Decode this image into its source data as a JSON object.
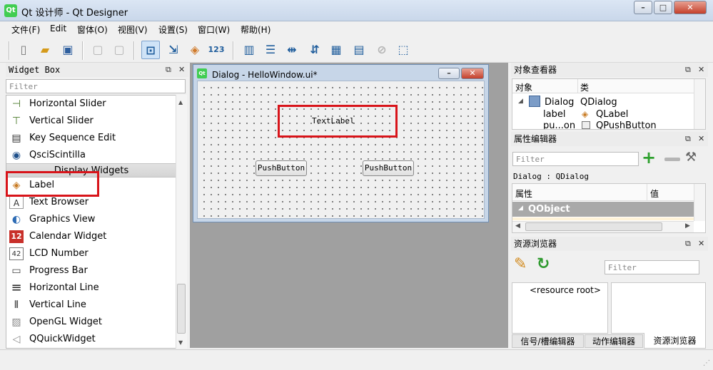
{
  "window": {
    "title": "Qt 设计师 - Qt Designer",
    "icon_text": "Qt",
    "minimize": "–",
    "maximize": "□",
    "close": "✕"
  },
  "menu": [
    "文件(F)",
    "Edit",
    "窗体(O)",
    "视图(V)",
    "设置(S)",
    "窗口(W)",
    "帮助(H)"
  ],
  "widget_box": {
    "title": "Widget Box",
    "float_glyph": "⧉",
    "close_glyph": "✕",
    "filter_placeholder": "Filter",
    "category": "Display Widgets",
    "items_top": [
      {
        "icon": "horizontal-slider-icon",
        "glyph": "⊣",
        "label": "Horizontal Slider"
      },
      {
        "icon": "vertical-slider-icon",
        "glyph": "⊤",
        "label": "Vertical Slider"
      },
      {
        "icon": "key-sequence-icon",
        "glyph": "▤",
        "label": "Key Sequence Edit"
      },
      {
        "icon": "qsci-icon",
        "glyph": "◉",
        "label": "QsciScintilla"
      }
    ],
    "items_display": [
      {
        "icon": "label-icon",
        "glyph": "◈",
        "label": "Label"
      },
      {
        "icon": "text-browser-icon",
        "glyph": "A",
        "label": "Text Browser"
      },
      {
        "icon": "graphics-view-icon",
        "glyph": "◐",
        "label": "Graphics View"
      },
      {
        "icon": "calendar-icon",
        "glyph": "12",
        "label": "Calendar Widget"
      },
      {
        "icon": "lcd-number-icon",
        "glyph": "42",
        "label": "LCD Number"
      },
      {
        "icon": "progress-bar-icon",
        "glyph": "▭",
        "label": "Progress Bar"
      },
      {
        "icon": "horizontal-line-icon",
        "glyph": "≡",
        "label": "Horizontal Line"
      },
      {
        "icon": "vertical-line-icon",
        "glyph": "⦀",
        "label": "Vertical Line"
      },
      {
        "icon": "opengl-icon",
        "glyph": "▨",
        "label": "OpenGL Widget"
      },
      {
        "icon": "quick-widget-icon",
        "glyph": "◁",
        "label": "QQuickWidget"
      }
    ]
  },
  "dialog": {
    "title": "Dialog - HelloWindow.ui*",
    "icon_text": "Qt",
    "text_label": "TextLabel",
    "button1": "PushButton",
    "button2": "PushButton"
  },
  "object_inspector": {
    "title": "对象查看器",
    "col_object": "对象",
    "col_class": "类",
    "rows": [
      {
        "object": "Dialog",
        "class": "QDialog"
      },
      {
        "object": "label",
        "class": "QLabel"
      },
      {
        "object": "pu...on",
        "class": "QPushButton"
      }
    ]
  },
  "property_editor": {
    "title": "属性编辑器",
    "filter_placeholder": "Filter",
    "context": "Dialog : QDialog",
    "col_property": "属性",
    "col_value": "值",
    "section": "QObject"
  },
  "resource_browser": {
    "title": "资源浏览器",
    "filter_placeholder": "Filter",
    "root": "<resource root>"
  },
  "bottom_tabs": [
    "信号/槽编辑器",
    "动作编辑器",
    "资源浏览器"
  ],
  "colors": {
    "highlight": "#d8141a",
    "section_bg": "#a9a9a9",
    "canvas": "#f0f0f0"
  }
}
